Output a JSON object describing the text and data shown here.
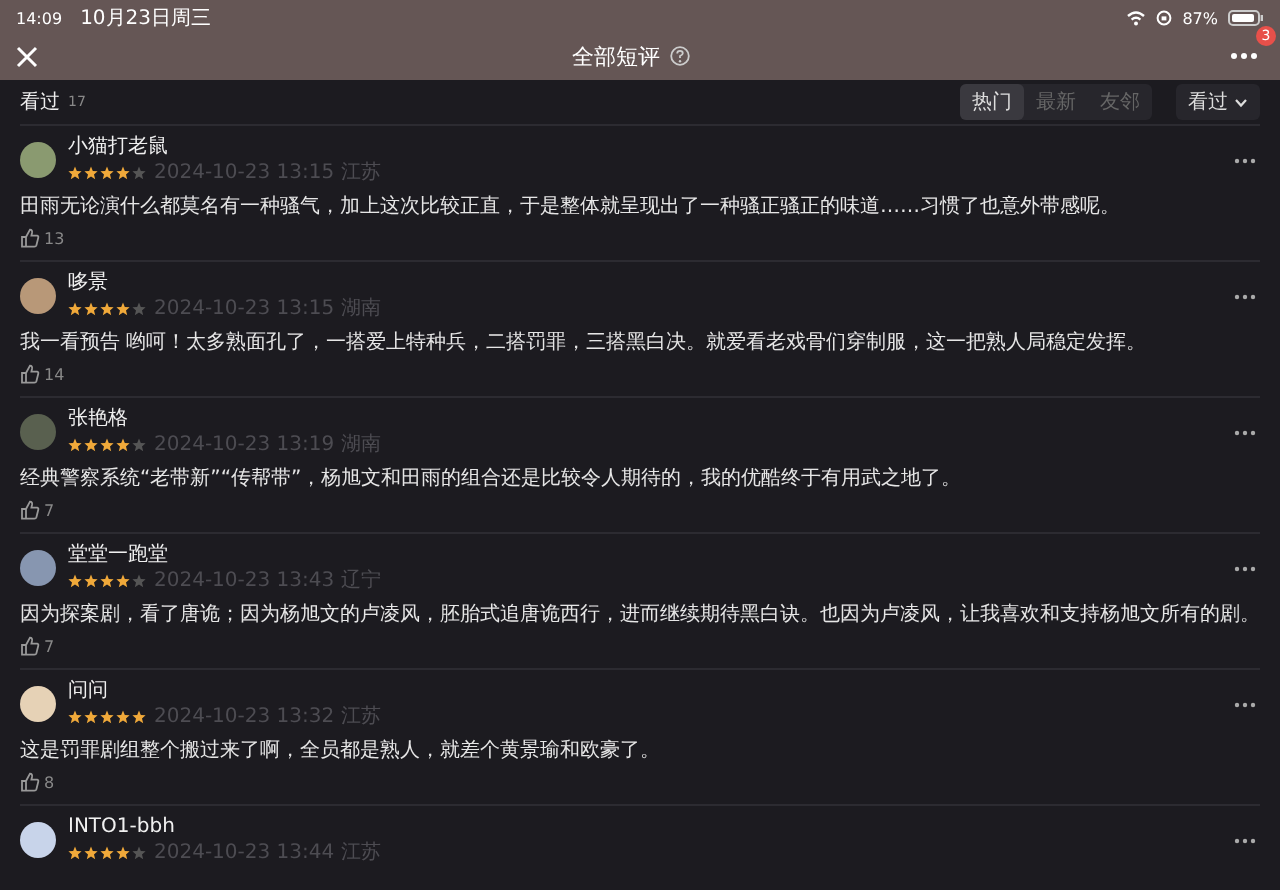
{
  "status_bar": {
    "time": "14:09",
    "date": "10月23日周三",
    "battery": "87%"
  },
  "nav": {
    "title": "全部短评",
    "badge": "3"
  },
  "filter": {
    "label": "看过",
    "count": "17",
    "tabs": [
      {
        "label": "热门",
        "selected": true
      },
      {
        "label": "最新",
        "selected": false
      },
      {
        "label": "友邻",
        "selected": false
      }
    ],
    "dropdown": "看过"
  },
  "comments": [
    {
      "name": "小猫打老鼠",
      "stars": 4,
      "meta": "2024-10-23 13:15 江苏",
      "text": "田雨无论演什么都莫名有一种骚气，加上这次比较正直，于是整体就呈现出了一种骚正骚正的味道……习惯了也意外带感呢。",
      "likes": "13"
    },
    {
      "name": "哆景",
      "stars": 4,
      "meta": "2024-10-23 13:15 湖南",
      "text": "我一看预告 哟呵！太多熟面孔了，一搭爱上特种兵，二搭罚罪，三搭黑白决。就爱看老戏骨们穿制服，这一把熟人局稳定发挥。",
      "likes": "14"
    },
    {
      "name": "张艳格",
      "stars": 4,
      "meta": "2024-10-23 13:19 湖南",
      "text": "经典警察系统“老带新”“传帮带”，杨旭文和田雨的组合还是比较令人期待的，我的优酷终于有用武之地了。",
      "likes": "7"
    },
    {
      "name": "堂堂一跑堂",
      "stars": 4,
      "meta": "2024-10-23 13:43 辽宁",
      "text": "因为探案剧，看了唐诡；因为杨旭文的卢凌风，胚胎式追唐诡西行，进而继续期待黑白诀。也因为卢凌风，让我喜欢和支持杨旭文所有的剧。",
      "likes": "7"
    },
    {
      "name": "问问",
      "stars": 5,
      "meta": "2024-10-23 13:32 江苏",
      "text": "这是罚罪剧组整个搬过来了啊，全员都是熟人，就差个黄景瑜和欧豪了。",
      "likes": "8"
    },
    {
      "name": "INTO1-bbh",
      "stars": 4,
      "meta": "2024-10-23 13:44 江苏"
    }
  ]
}
